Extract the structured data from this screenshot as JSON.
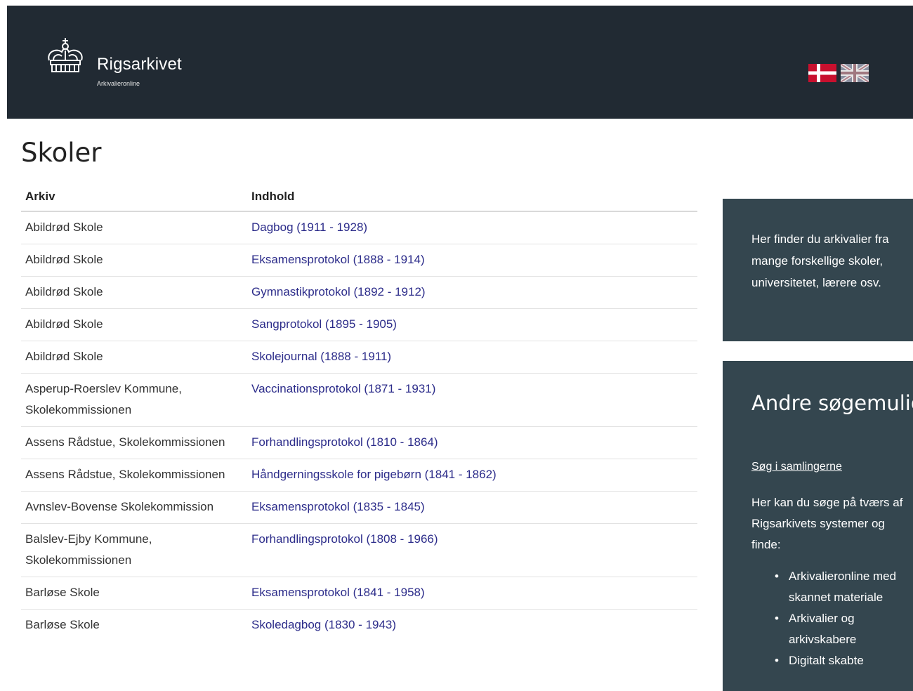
{
  "header": {
    "logo_title": "Rigsarkivet",
    "logo_subtitle": "Arkivalieronline",
    "flag_da_icon": "danish-flag-icon",
    "flag_en_icon": "uk-flag-icon"
  },
  "page": {
    "title": "Skoler"
  },
  "table": {
    "columns": [
      "Arkiv",
      "Indhold"
    ],
    "rows": [
      {
        "arkiv": "Abildrød Skole",
        "indhold": "Dagbog (1911 - 1928)"
      },
      {
        "arkiv": "Abildrød Skole",
        "indhold": "Eksamensprotokol (1888 - 1914)"
      },
      {
        "arkiv": "Abildrød Skole",
        "indhold": "Gymnastikprotokol (1892 - 1912)"
      },
      {
        "arkiv": "Abildrød Skole",
        "indhold": "Sangprotokol (1895 - 1905)"
      },
      {
        "arkiv": "Abildrød Skole",
        "indhold": "Skolejournal (1888 - 1911)"
      },
      {
        "arkiv": "Asperup-Roerslev Kommune, Skolekommissionen",
        "indhold": "Vaccinationsprotokol (1871 - 1931)"
      },
      {
        "arkiv": "Assens Rådstue, Skolekommissionen",
        "indhold": "Forhandlingsprotokol (1810 - 1864)"
      },
      {
        "arkiv": "Assens Rådstue, Skolekommissionen",
        "indhold": "Håndgerningsskole for pigebørn (1841 - 1862)"
      },
      {
        "arkiv": "Avnslev-Bovense Skolekommission",
        "indhold": "Eksamensprotokol (1835 - 1845)"
      },
      {
        "arkiv": "Balslev-Ejby Kommune, Skolekommissionen",
        "indhold": "Forhandlingsprotokol (1808 - 1966)"
      },
      {
        "arkiv": "Barløse Skole",
        "indhold": "Eksamensprotokol (1841 - 1958)"
      },
      {
        "arkiv": "Barløse Skole",
        "indhold": "Skoledagbog (1830 - 1943)"
      }
    ]
  },
  "sidebar": {
    "info_text": "Her finder du arkivalier fra mange forskellige skoler, universitetet, lærere osv.",
    "other_title": "Andre søgemuligheder",
    "search_link": "Søg i samlingerne",
    "search_desc": "Her kan du søge på tværs af Rigsarkivets systemer og finde:",
    "list": [
      "Arkivalieronline med skannet materiale",
      "Arkivalier og arkivskabere",
      "Digitalt skabte"
    ]
  },
  "colors": {
    "header_bg": "#212a33",
    "sidebar_bg": "#34464f",
    "link": "#2c2c8a"
  }
}
